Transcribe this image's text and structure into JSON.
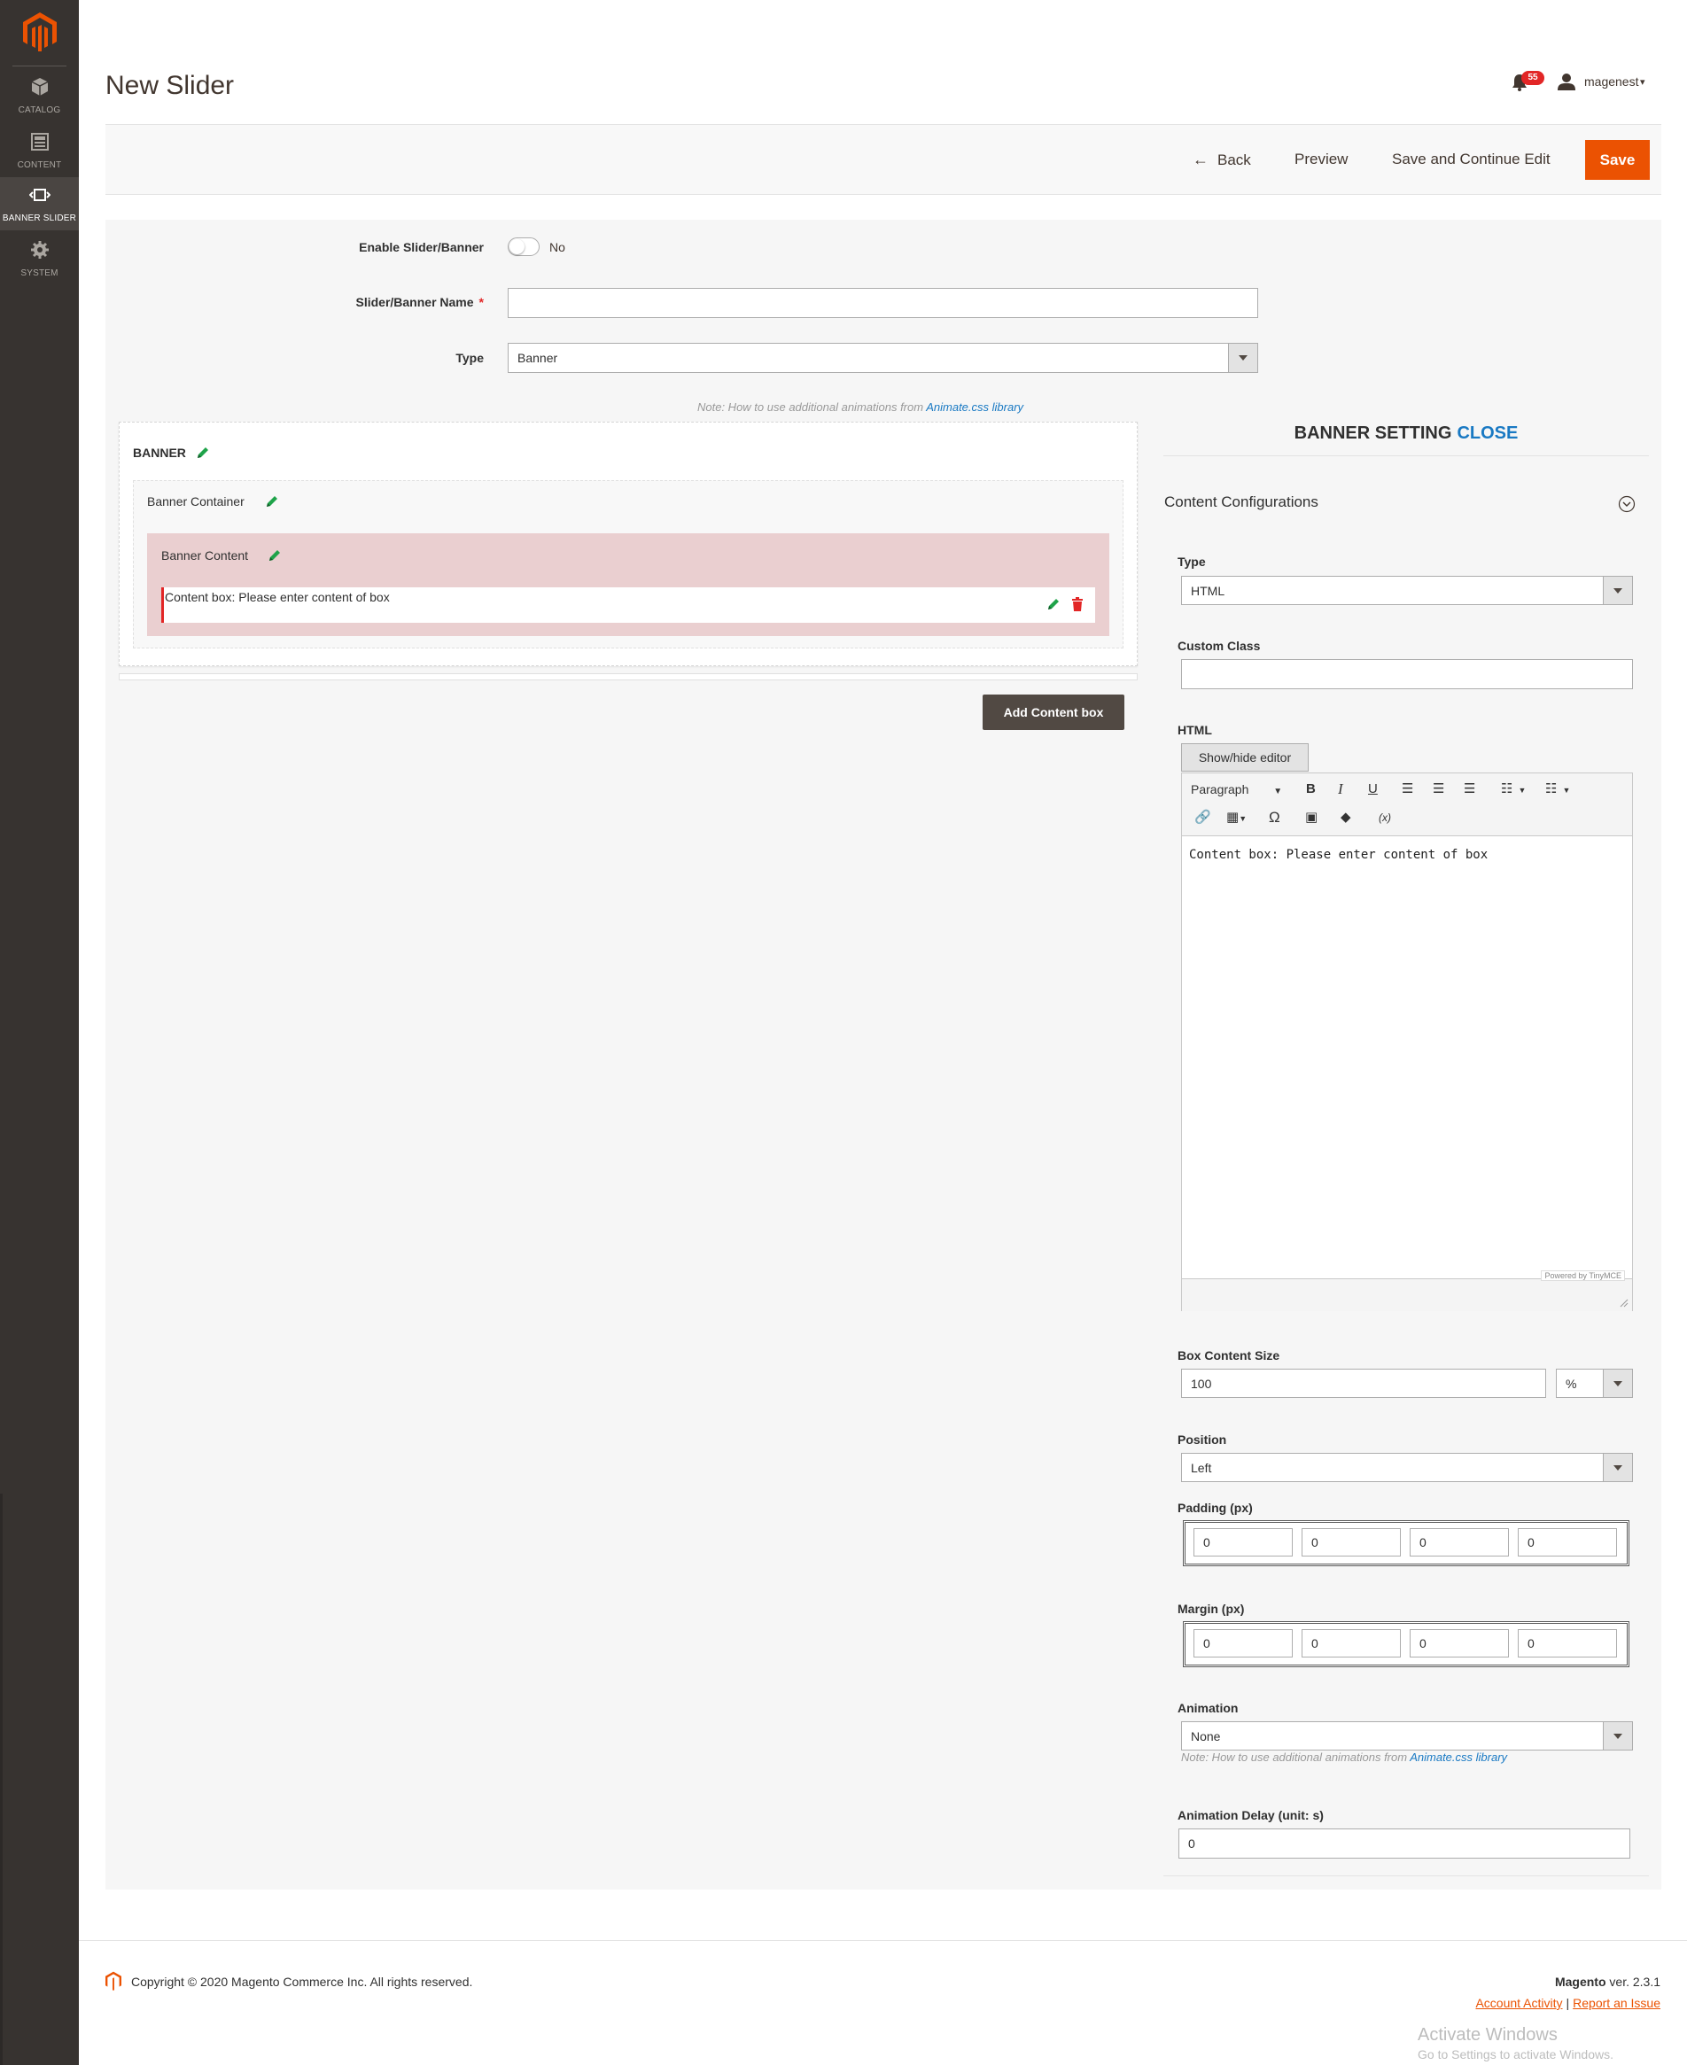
{
  "sidebar": {
    "items": [
      {
        "label": "CATALOG",
        "icon": "cube-icon"
      },
      {
        "label": "CONTENT",
        "icon": "layout-icon"
      },
      {
        "label": "BANNER SLIDER",
        "icon": "slider-icon"
      },
      {
        "label": "SYSTEM",
        "icon": "gear-icon"
      }
    ],
    "active": "BANNER SLIDER"
  },
  "header": {
    "title": "New Slider",
    "notifications_count": "55",
    "user": "magenest"
  },
  "actions": {
    "back": "Back",
    "preview": "Preview",
    "save_continue": "Save and Continue Edit",
    "save": "Save"
  },
  "form": {
    "enable_label": "Enable Slider/Banner",
    "enable_value": "No",
    "name_label": "Slider/Banner Name",
    "name_required": "*",
    "name_value": "",
    "type_label": "Type",
    "type_value": "Banner",
    "note_prefix": "Note: How to use additional animations from ",
    "note_link": "Animate.css library"
  },
  "builder": {
    "banner_title": "BANNER",
    "container_title": "Banner Container",
    "content_title": "Banner Content",
    "content_box_text": "Content box: Please enter content of box",
    "add_button": "Add Content box"
  },
  "settings": {
    "head": "BANNER SETTING",
    "close": "CLOSE",
    "section_title": "Content Configurations",
    "type_label": "Type",
    "type_value": "HTML",
    "custom_class_label": "Custom Class",
    "custom_class_value": "",
    "html_label": "HTML",
    "show_hide": "Show/hide editor",
    "editor": {
      "format": "Paragraph",
      "content": "Content box: Please enter content of box",
      "powered": "Powered by TinyMCE"
    },
    "box_size_label": "Box Content Size",
    "box_size_value": "100",
    "box_size_unit": "%",
    "position_label": "Position",
    "position_value": "Left",
    "padding_label": "Padding (px)",
    "padding": [
      "0",
      "0",
      "0",
      "0"
    ],
    "margin_label": "Margin (px)",
    "margin": [
      "0",
      "0",
      "0",
      "0"
    ],
    "animation_label": "Animation",
    "animation_value": "None",
    "animation_note_prefix": "Note: How to use additional animations from ",
    "animation_note_link": "Animate.css library",
    "delay_label": "Animation Delay (unit: s)",
    "delay_value": "0"
  },
  "footer": {
    "copyright": "Copyright © 2020 Magento Commerce Inc. All rights reserved.",
    "brand": "Magento",
    "version": " ver. 2.3.1",
    "account_activity": "Account Activity",
    "separator": "|",
    "report_issue": "Report an Issue"
  },
  "os_overlay": {
    "title": "Activate Windows",
    "subtitle": "Go to Settings to activate Windows."
  },
  "colors": {
    "accent": "#eb5202",
    "sidebar": "#373330",
    "link": "#1979c3",
    "banner_content_bg": "#eacfd0"
  }
}
